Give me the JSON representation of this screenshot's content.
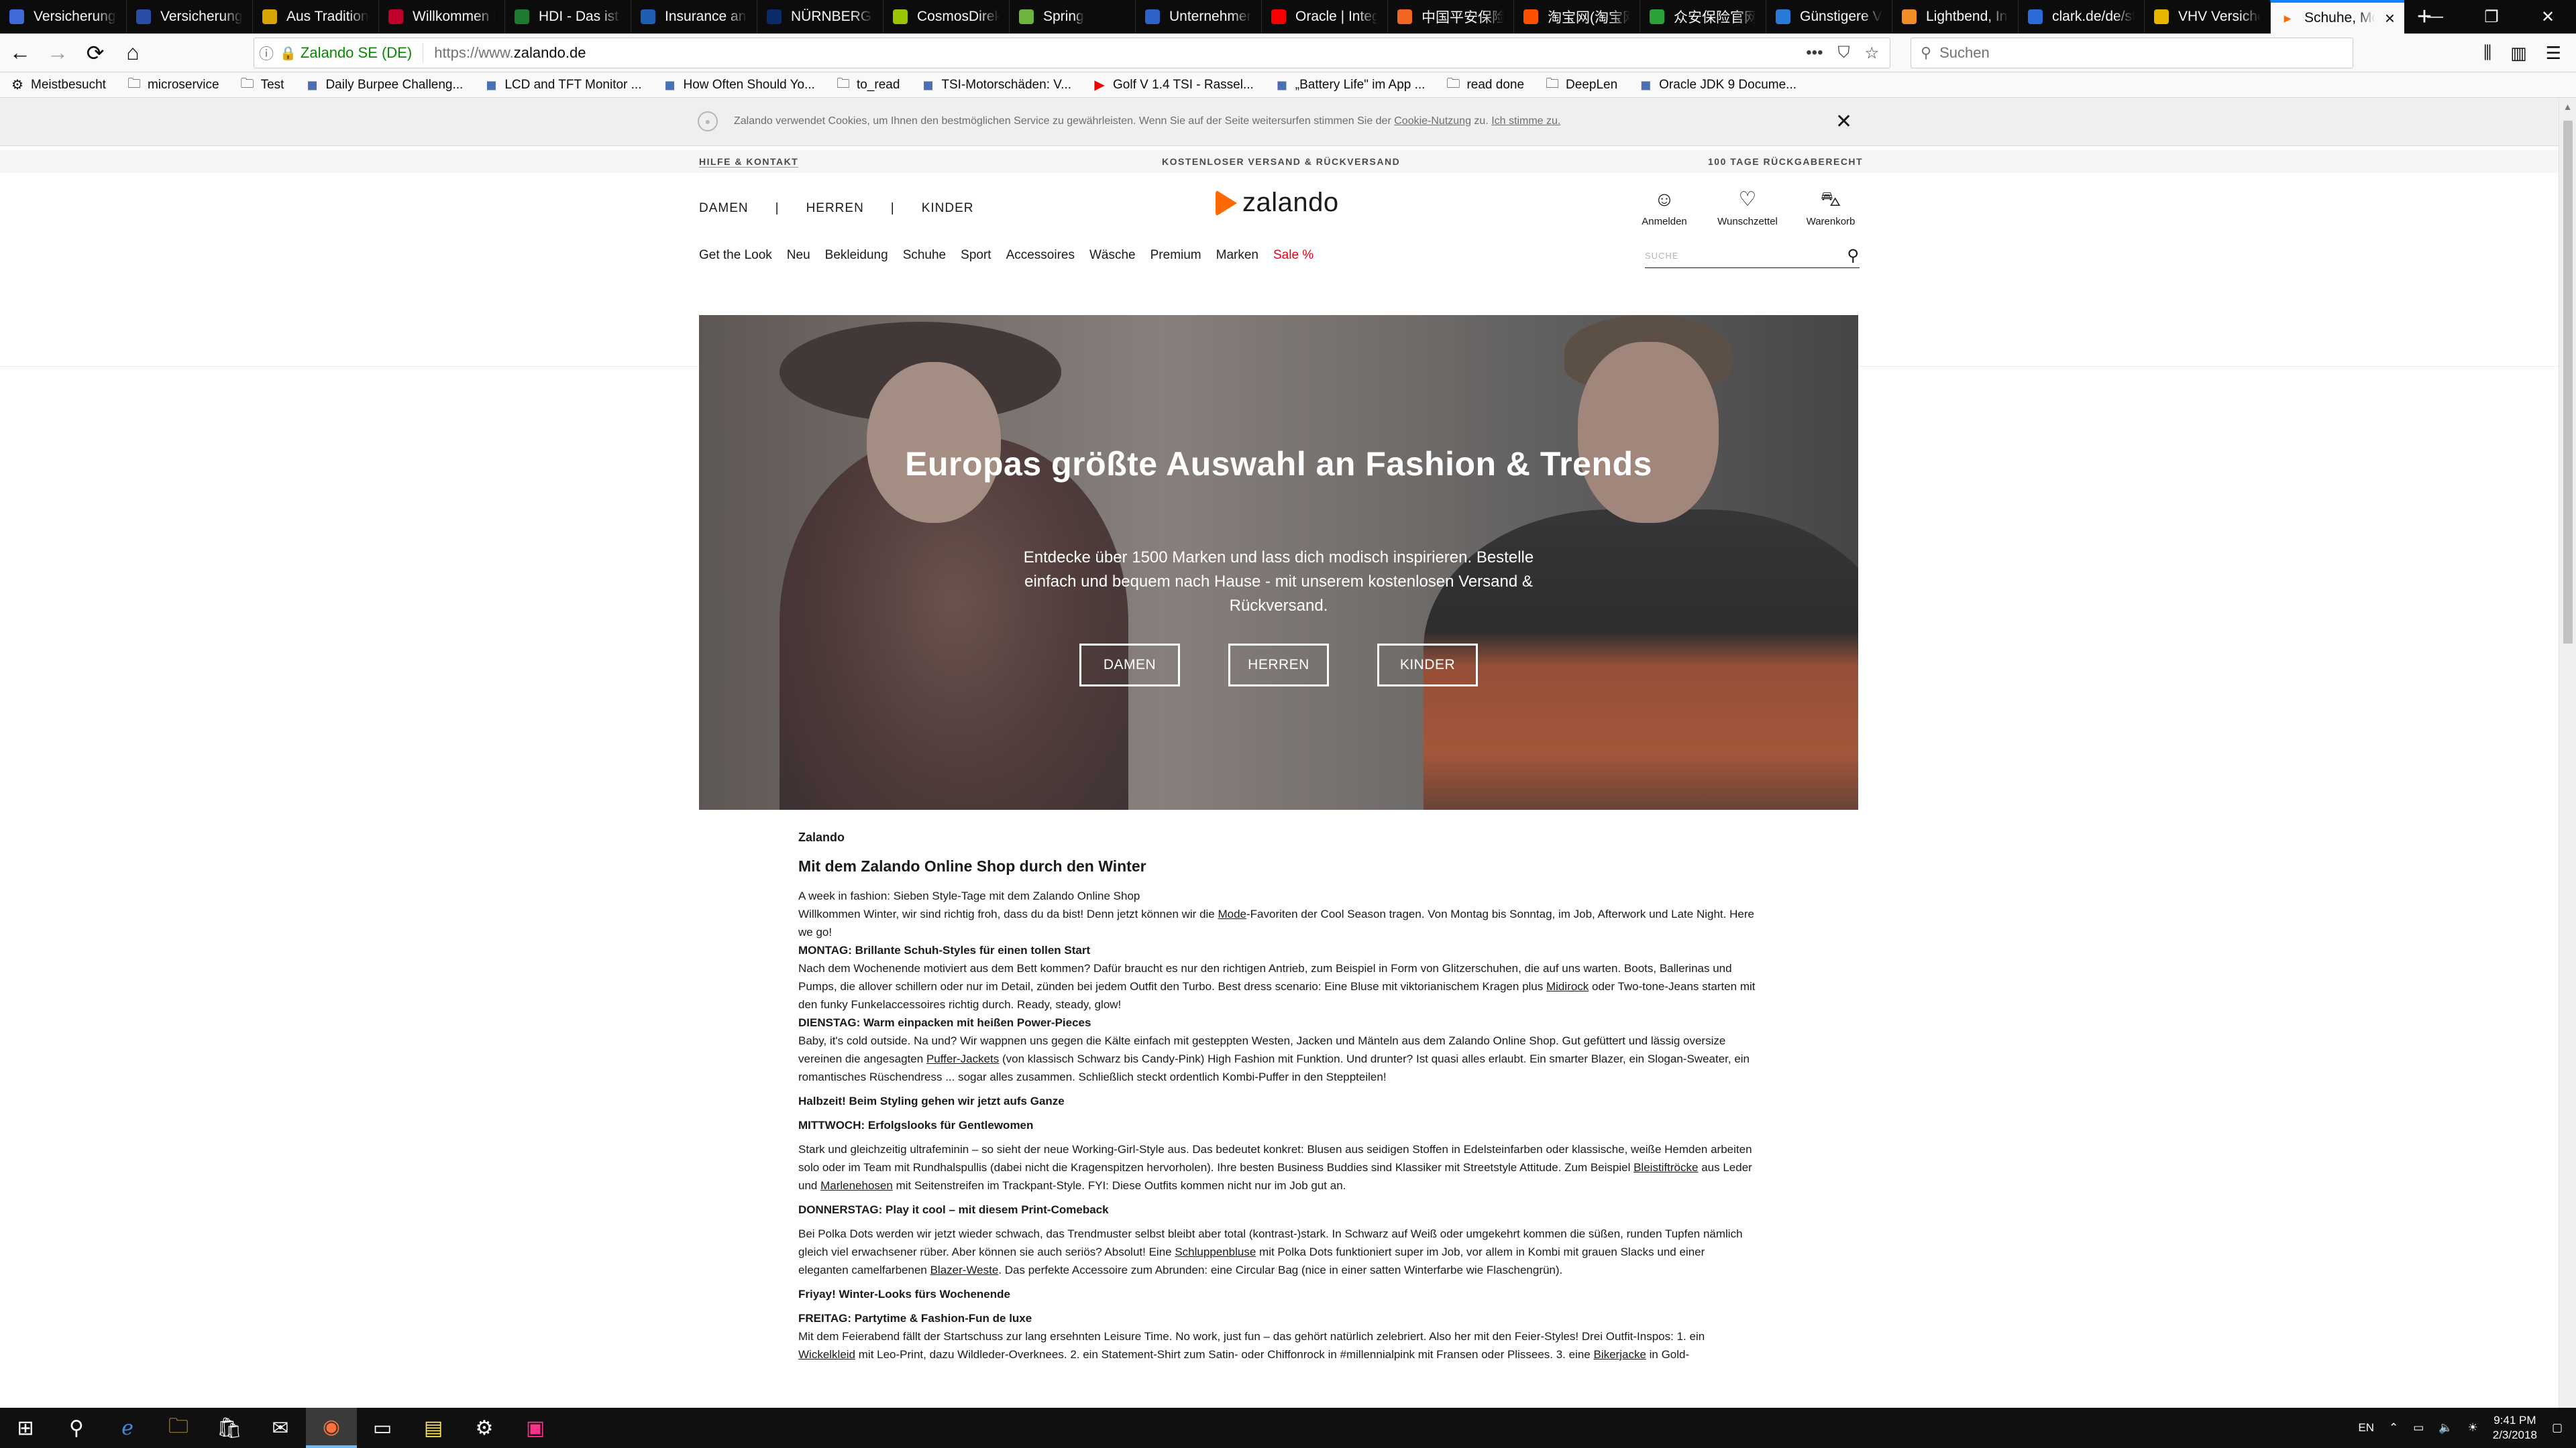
{
  "tabs": [
    {
      "label": "Versicherung. V",
      "icon": "generic-site-icon",
      "color": "#3f6ad8"
    },
    {
      "label": "Versicherungen",
      "icon": "generic-site-icon",
      "color": "#2a4ea6"
    },
    {
      "label": "Aus Tradition g",
      "icon": "shield-icon",
      "color": "#d9a400"
    },
    {
      "label": "Willkommen b",
      "icon": "generic-site-icon",
      "color": "#c0002a"
    },
    {
      "label": "HDI - Das ist V",
      "icon": "generic-site-icon",
      "color": "#1e7a2f"
    },
    {
      "label": "Insurance and",
      "icon": "generic-site-icon",
      "color": "#1f5fb3"
    },
    {
      "label": "NÜRNBERGER",
      "icon": "generic-site-icon",
      "color": "#0a2a6a"
    },
    {
      "label": "CosmosDirekt",
      "icon": "generic-site-icon",
      "color": "#9bc400"
    },
    {
      "label": "Spring",
      "icon": "leaf-icon",
      "color": "#6db33f"
    },
    {
      "label": "Unternehmens",
      "icon": "generic-site-icon",
      "color": "#2d62c8"
    },
    {
      "label": "Oracle | Integr",
      "icon": "generic-site-icon",
      "color": "#f80000"
    },
    {
      "label": "中国平安保险",
      "icon": "generic-site-icon",
      "color": "#f26522"
    },
    {
      "label": "淘宝网(淘宝网",
      "icon": "generic-site-icon",
      "color": "#ff5000"
    },
    {
      "label": "众安保险官网",
      "icon": "generic-site-icon",
      "color": "#29a33a"
    },
    {
      "label": "Günstigere Ve",
      "icon": "shield-icon",
      "color": "#2a7bd8"
    },
    {
      "label": "Lightbend, Inc",
      "icon": "generic-site-icon",
      "color": "#f28c28"
    },
    {
      "label": "clark.de/de/sta",
      "icon": "generic-site-icon",
      "color": "#2a6bd8"
    },
    {
      "label": "VHV Versicher",
      "icon": "generic-site-icon",
      "color": "#e8b400"
    },
    {
      "label": "Schuhe, Mo",
      "icon": "zalando-play-icon",
      "color": "#ff6900"
    }
  ],
  "urlbar": {
    "identity": "Zalando SE (DE)",
    "protocol": "https://www.",
    "host": "zalando.de",
    "page_actions": "•••"
  },
  "search": {
    "placeholder": "Suchen"
  },
  "bookmarks": [
    {
      "label": "Meistbesucht",
      "icon": "gear-icon"
    },
    {
      "label": "microservice",
      "icon": "folder-icon"
    },
    {
      "label": "Test",
      "icon": "folder-icon"
    },
    {
      "label": "Daily Burpee Challeng...",
      "icon": "generic-site-icon"
    },
    {
      "label": "LCD and TFT Monitor ...",
      "icon": "generic-site-icon"
    },
    {
      "label": "How Often Should Yo...",
      "icon": "generic-site-icon"
    },
    {
      "label": "to_read",
      "icon": "folder-icon"
    },
    {
      "label": "TSI-Motorschäden: V...",
      "icon": "generic-site-icon"
    },
    {
      "label": "Golf V 1.4 TSI - Rassel...",
      "icon": "youtube-icon"
    },
    {
      "label": "„Battery Life\" im App ...",
      "icon": "generic-site-icon"
    },
    {
      "label": "read done",
      "icon": "folder-icon"
    },
    {
      "label": "DeepLen",
      "icon": "folder-icon"
    },
    {
      "label": "Oracle JDK 9 Docume...",
      "icon": "generic-site-icon"
    }
  ],
  "cookie": {
    "text_before": "Zalando verwendet Cookies, um Ihnen den bestmöglichen Service zu gewährleisten. Wenn Sie auf der Seite weitersurfen stimmen Sie der ",
    "link_usage": "Cookie-Nutzung",
    "text_mid": " zu. ",
    "link_agree": "Ich stimme zu."
  },
  "topstrip": {
    "help": "HILFE & KONTAKT",
    "shipping": "KOSTENLOSER VERSAND & RÜCKVERSAND",
    "returns": "100 TAGE RÜCKGABERECHT"
  },
  "header": {
    "gender_links": [
      "DAMEN",
      "HERREN",
      "KINDER"
    ],
    "logo_text": "zalando",
    "actions": {
      "login": "Anmelden",
      "wishlist": "Wunschzettel",
      "cart": "Warenkorb"
    },
    "categories": [
      "Get the Look",
      "Neu",
      "Bekleidung",
      "Schuhe",
      "Sport",
      "Accessoires",
      "Wäsche",
      "Premium",
      "Marken",
      "Sale %"
    ],
    "search_placeholder": "SUCHE",
    "sale_color": "#e2001a",
    "brand_color": "#ff6900"
  },
  "hero": {
    "title": "Europas größte Auswahl an Fashion & Trends",
    "subtitle": "Entdecke über 1500 Marken und lass dich modisch inspirieren. Bestelle einfach und bequem nach Hause - mit unserem kostenlosen Versand & Rückversand.",
    "buttons": [
      "DAMEN",
      "HERREN",
      "KINDER"
    ]
  },
  "article": {
    "brand": "Zalando",
    "title": "Mit dem Zalando Online Shop durch den Winter",
    "intro_1": "A week in fashion: Sieben Style-Tage mit dem Zalando Online Shop",
    "intro_2a": "Willkommen Winter, wir sind richtig froh, dass du da bist! Denn jetzt können wir die ",
    "intro_2_link": "Mode",
    "intro_2b": "-Favoriten der Cool Season tragen. Von Montag bis Sonntag, im Job, Afterwork und Late Night. Here we go!",
    "montag_h": "MONTAG: Brillante Schuh-Styles für einen tollen Start",
    "montag_a": "Nach dem Wochenende motiviert aus dem Bett kommen? Dafür braucht es nur den richtigen Antrieb, zum Beispiel in Form von Glitzerschuhen, die auf uns warten. Boots, Ballerinas und Pumps, die allover schillern oder nur im Detail, zünden bei jedem Outfit den Turbo. Best dress scenario: Eine Bluse mit viktorianischem Kragen plus ",
    "montag_link": "Midirock",
    "montag_b": " oder Two-tone-Jeans starten mit den funky Funkelaccessoires richtig durch. Ready, steady, glow!",
    "dienstag_h": "DIENSTAG: Warm einpacken mit heißen Power-Pieces",
    "dienstag_a": "Baby, it's cold outside. Na und? Wir wappnen uns gegen die Kälte einfach mit gesteppten Westen, Jacken und Mänteln aus dem Zalando Online Shop. Gut gefüttert und lässig oversize vereinen die angesagten ",
    "dienstag_link": "Puffer-Jackets",
    "dienstag_b": " (von klassisch Schwarz bis Candy-Pink) High Fashion mit Funktion. Und drunter? Ist quasi alles erlaubt. Ein smarter Blazer, ein Slogan-Sweater, ein romantisches Rüschendress ... sogar alles zusammen. Schließlich steckt ordentlich Kombi-Puffer in den Steppteilen!",
    "halbzeit_h": "Halbzeit! Beim Styling gehen wir jetzt aufs Ganze",
    "mittwoch_h": "MITTWOCH: Erfolgslooks für Gentlewomen",
    "mittwoch_a": "Stark und gleichzeitig ultrafeminin – so sieht der neue Working-Girl-Style aus. Das bedeutet konkret: Blusen aus seidigen Stoffen in Edelsteinfarben oder klassische, weiße Hemden arbeiten solo oder im Team mit Rundhalspullis (dabei nicht die Kragenspitzen hervorholen). Ihre besten Business Buddies sind Klassiker mit Streetstyle Attitude. Zum Beispiel ",
    "mittwoch_link1": "Bleistiftröcke",
    "mittwoch_b": " aus Leder und ",
    "mittwoch_link2": "Marlenehosen",
    "mittwoch_c": " mit Seitenstreifen im Trackpant-Style. FYI: Diese Outfits kommen nicht nur im Job gut an.",
    "donnerstag_h": "DONNERSTAG: Play it cool – mit diesem Print-Comeback",
    "donnerstag_a": "Bei Polka Dots werden wir jetzt wieder schwach, das Trendmuster selbst bleibt aber total (kontrast-)stark. In Schwarz auf Weiß oder umgekehrt kommen die süßen, runden Tupfen nämlich gleich viel erwachsener rüber. Aber können sie auch seriös? Absolut! Eine ",
    "donnerstag_link1": "Schluppenbluse",
    "donnerstag_b": " mit Polka Dots funktioniert super im Job, vor allem in Kombi mit grauen Slacks und einer eleganten camelfarbenen ",
    "donnerstag_link2": "Blazer-Weste",
    "donnerstag_c": ". Das perfekte Accessoire zum Abrunden: eine Circular Bag (nice in einer satten Winterfarbe wie Flaschengrün).",
    "friyay_h": "Friyay! Winter-Looks fürs Wochenende",
    "freitag_h": "FREITAG: Partytime & Fashion-Fun de luxe",
    "freitag_a": "Mit dem Feierabend fällt der Startschuss zur lang ersehnten Leisure Time. No work, just fun – das gehört natürlich zelebriert. Also her mit den Feier-Styles! Drei Outfit-Inspos: 1. ein ",
    "freitag_link1": "Wickelkleid",
    "freitag_b": " mit Leo-Print, dazu Wildleder-Overknees. 2. ein Statement-Shirt zum Satin- oder Chiffonrock in #millennialpink mit Fransen oder Plissees. 3. eine ",
    "freitag_link2": "Bikerjacke",
    "freitag_c": " in Gold-"
  },
  "taskbar": {
    "lang": "EN",
    "time": "9:41 PM",
    "date": "2/3/2018",
    "apps": [
      "windows-start-icon",
      "search-icon",
      "edge-browser-icon",
      "file-explorer-icon",
      "store-icon",
      "mail-icon",
      "firefox-icon",
      "terminal-icon",
      "sticky-notes-icon",
      "settings-gear-icon",
      "intellij-icon"
    ]
  }
}
